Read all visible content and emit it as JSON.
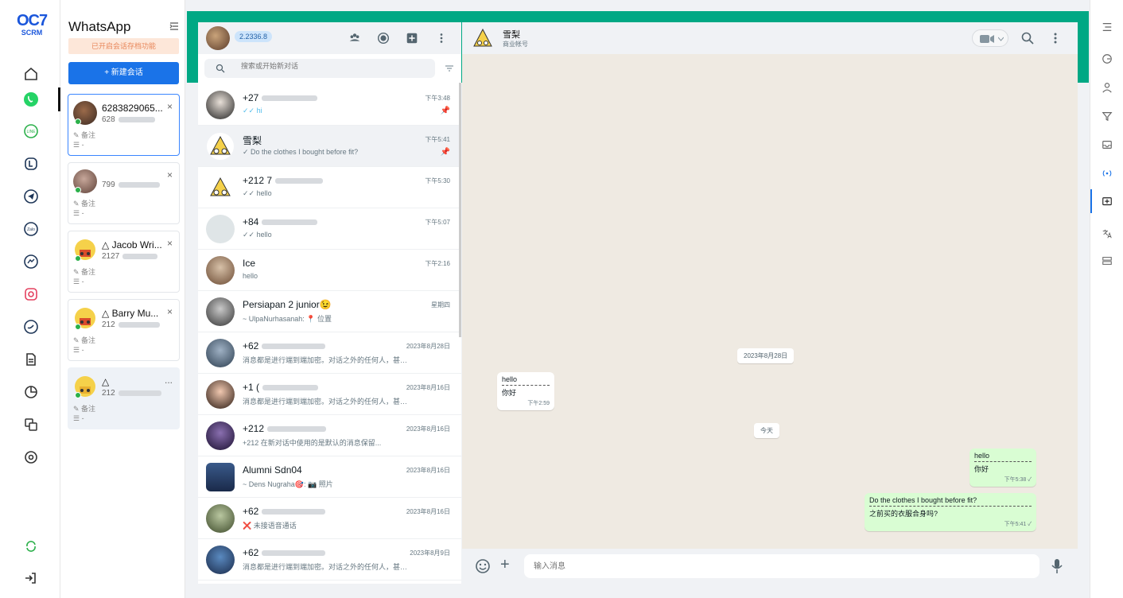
{
  "brand": {
    "line1": "OC7",
    "line2": "SCRM"
  },
  "sessions": {
    "title": "WhatsApp",
    "assist_notice": "已开启会话存档功能",
    "new_button": "+ 新建会话",
    "cards": [
      {
        "name": "6283829065...",
        "number": "628",
        "note": "备注",
        "tag": "-",
        "online": true,
        "close": "×"
      },
      {
        "name": "",
        "number": "799",
        "note": "备注",
        "tag": "-",
        "online": true,
        "close": "×"
      },
      {
        "name": "△ Jacob Wri...",
        "number": "2127",
        "note": "备注",
        "tag": "-",
        "online": true,
        "close": "×"
      },
      {
        "name": "△ Barry Mu...",
        "number": "212",
        "note": "备注",
        "tag": "-",
        "online": true,
        "close": "×"
      },
      {
        "name": "△",
        "number": "212",
        "note": "备注",
        "tag": "-",
        "online": true,
        "close": "..."
      }
    ]
  },
  "chatlist": {
    "version_badge": "2.2336.8",
    "search_placeholder": "搜索或开始新对话",
    "chats": [
      {
        "name": "+27",
        "preview": "✓✓ hi",
        "time": "下午3:48",
        "pin": true
      },
      {
        "name": "雪梨",
        "preview": "✓ Do the clothes I bought before fit?",
        "time": "下午5:41",
        "pin": true,
        "active": true
      },
      {
        "name": "+212 7",
        "preview": "✓✓ hello",
        "time": "下午5:30",
        "pin": false
      },
      {
        "name": "+84",
        "preview": "✓✓ hello",
        "time": "下午5:07",
        "pin": false
      },
      {
        "name": "Ice",
        "preview": "hello",
        "time": "下午2:16",
        "pin": false
      },
      {
        "name": "Persiapan 2 junior😉",
        "preview": "~ UlpaNurhasanah: 📍 位置",
        "time": "星期四",
        "pin": false
      },
      {
        "name": "+62",
        "preview": "消息都是进行端到端加密。对话之外的任何人，甚至包...",
        "time": "2023年8月28日",
        "pin": false
      },
      {
        "name": "+1 (",
        "preview": "消息都是进行端到端加密。对话之外的任何人，甚至包...",
        "time": "2023年8月16日",
        "pin": false
      },
      {
        "name": "+212",
        "preview": "+212 在新对话中使用的是默认的消息保留...",
        "time": "2023年8月16日",
        "pin": false
      },
      {
        "name": "Alumni Sdn04",
        "preview": "~ Dens Nugraha🎯: 📷 照片",
        "time": "2023年8月16日",
        "pin": false
      },
      {
        "name": "+62",
        "preview": "❌ 未接语音通话",
        "time": "2023年8月16日",
        "pin": false
      },
      {
        "name": "+62",
        "preview": "消息都是进行端到端加密。对话之外的任何人，甚至包...",
        "time": "2023年8月9日",
        "pin": false
      }
    ]
  },
  "conversation": {
    "name": "雪梨",
    "subtitle": "商业帐号",
    "date_chip_1": "2023年8月28日",
    "date_chip_2": "今天",
    "incoming": {
      "line1": "hello",
      "line2": "你好",
      "time": "下午2:59"
    },
    "outgoing_1": {
      "line1": "hello",
      "line2": "你好",
      "time": "下午5:38 ✓"
    },
    "outgoing_2": {
      "line1": "Do the clothes I bought before fit?",
      "line2": "之前买的衣服合身吗?",
      "time": "下午5:41 ✓"
    },
    "input_placeholder": "输入消息"
  },
  "colors": {
    "accent": "#00a884",
    "brand": "#1a73e8",
    "bubble_out": "#d9fdd3"
  }
}
